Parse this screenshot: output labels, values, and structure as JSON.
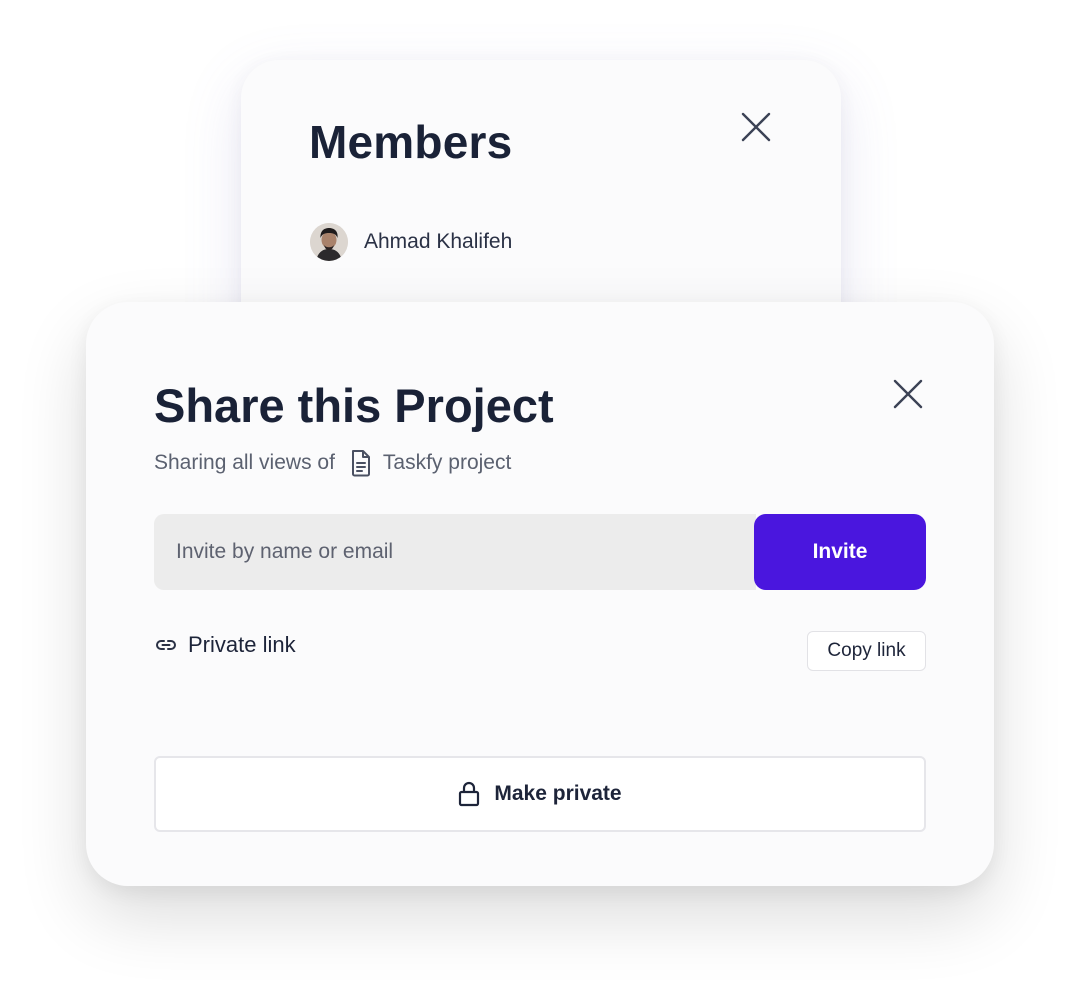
{
  "members_dialog": {
    "title": "Members",
    "members": [
      {
        "name": "Ahmad Khalifeh",
        "avatar_icon": "user-avatar"
      }
    ],
    "close_icon": "close-icon"
  },
  "share_dialog": {
    "title": "Share this Project",
    "subtitle_prefix": "Sharing all views of",
    "subtitle_icon": "document-icon",
    "project_name": "Taskfy project",
    "invite_placeholder": "Invite by name or email",
    "invite_value": "",
    "invite_button": "Invite",
    "private_link_icon": "link-icon",
    "private_link_label": "Private link",
    "copy_link_button": "Copy link",
    "make_private_icon": "lock-icon",
    "make_private_button": "Make private",
    "close_icon": "close-icon"
  },
  "colors": {
    "accent": "#4a16de",
    "title_text": "#1a2237",
    "muted_text": "#5b6170",
    "input_bg": "#ececec",
    "card_bg": "#fbfbfc"
  }
}
